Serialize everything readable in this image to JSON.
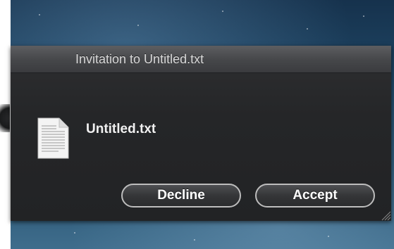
{
  "dialog": {
    "title": "Invitation to Untitled.txt",
    "file_name": "Untitled.txt",
    "file_icon": "text-document-icon",
    "decline_label": "Decline",
    "accept_label": "Accept"
  },
  "colors": {
    "panel_background": "#252628",
    "titlebar_background": "#47484b",
    "button_border": "#bdbdbd",
    "desktop_background": "#1f4766"
  }
}
